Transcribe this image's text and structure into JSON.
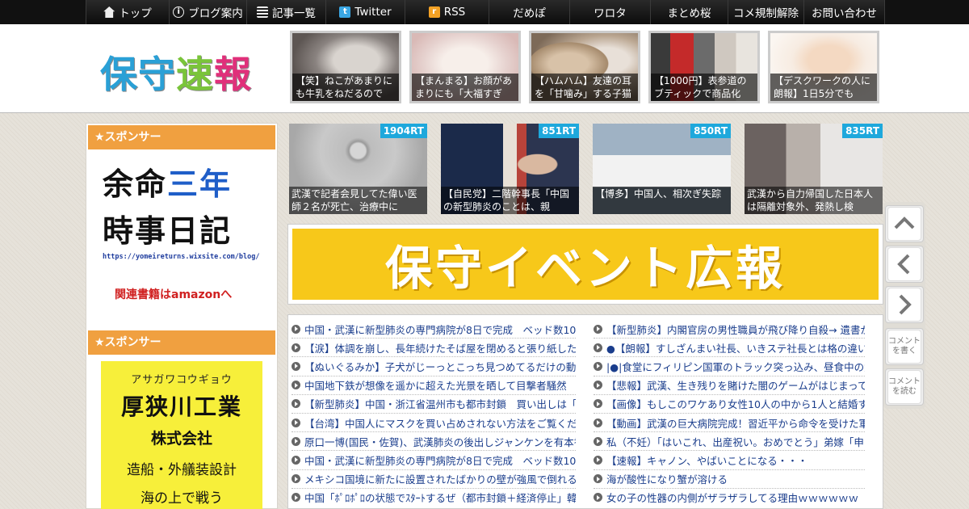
{
  "nav": {
    "items": [
      {
        "label": "トップ",
        "icon": "home-icon",
        "w": 104
      },
      {
        "label": "ブログ案内",
        "icon": "info-icon",
        "w": 96
      },
      {
        "label": "記事一覧",
        "icon": "list-icon",
        "w": 98
      },
      {
        "label": "Twitter",
        "icon": "twitter-icon",
        "w": 98
      },
      {
        "label": "RSS",
        "icon": "rss-icon",
        "w": 104
      },
      {
        "label": "だめぽ",
        "icon": "",
        "w": 100
      },
      {
        "label": "ワロタ",
        "icon": "",
        "w": 100
      },
      {
        "label": "まとめ桜",
        "icon": "",
        "w": 96
      },
      {
        "label": "コメ規制解除",
        "icon": "",
        "w": 94
      },
      {
        "label": "お問い合わせ",
        "icon": "",
        "w": 100
      }
    ]
  },
  "site": {
    "logo": [
      "保",
      "守",
      "速",
      "報"
    ]
  },
  "header_tiles": [
    {
      "caption": "【笑】ねこがあまりにも牛乳をねだるので"
    },
    {
      "caption": "【まんまる】お顔があまりにも「大福すぎる」"
    },
    {
      "caption": "【ハムハム】友達の耳を「甘噛み」する子猫"
    },
    {
      "caption": "【1000円】表参道のブティックで商品化"
    },
    {
      "caption": "【デスクワークの人に朗報】1日5分でも"
    }
  ],
  "sidebar": {
    "sponsor_label": "★スポンサー",
    "ad1": {
      "line1_a": "余命",
      "line1_b": "三年",
      "line2": "時事日記",
      "url": "https://yomeireturns.wixsite.com/blog/",
      "amazon": "関連書籍はamazonへ"
    },
    "ad2": {
      "sub": "アサガワコウギョウ",
      "title": "厚狭川工業",
      "company": "株式会社",
      "biz": "造船・外艤装設計",
      "more": "海の上で戦う"
    }
  },
  "ranking": [
    {
      "rt": "1904RT",
      "caption": "武漢で記者会見してた偉い医師２名が死亡、治療中に"
    },
    {
      "rt": "851RT",
      "caption": "【自民党】二階幹事長「中国の新型肺炎のことは、親"
    },
    {
      "rt": "850RT",
      "caption": "【博多】中国人、相次ぎ失踪"
    },
    {
      "rt": "835RT",
      "caption": "武漢から自力帰国した日本人は隔離対象外、発熱し検"
    }
  ],
  "banner": {
    "text": "保守イベント広報"
  },
  "articles_left": [
    "中国・武漢に新型肺炎の専門病院が8日で完成　ベッド数1000床",
    "【涙】体調を崩し、長年続けたそば屋を閉めると張り紙した。",
    "【ぬいぐるみか】子犬がじーっとこっち見つめてるだけの動画",
    "中国地下鉄が想像を遥かに超えた光景を晒して目撃者騒然　こ",
    "【新型肺炎】中国・浙江省温州市も都市封鎖　買い出しは「2日",
    "【台湾】中国人にマスクを買い占めされない方法をご覧ください",
    "原口一博(国民・佐賀)、武漢肺炎の後出しジャンケンを有本香氏",
    "中国・武漢に新型肺炎の専門病院が8日で完成　ベッド数1000床",
    "メキシコ国境に新たに設置されたばかりの壁が強風で倒れる",
    "中国「ﾎﾟﾛﾎﾟﾛの状態でｽﾀｰﾄするぜ（都市封鎖＋経済停止」韓国"
  ],
  "articles_right": [
    "【新型肺炎】内閣官房の男性職員が飛び降り自殺→ 遺書が・・",
    "●【朗報】すしざんまい社長、いきステ社長とは格の違いを見せ",
    "|●|食堂にフィリピン国軍のトラック突っ込み、昼食中の女子高",
    "【悲報】武漢、生き残りを賭けた闇のゲームがはじまってしまう",
    "【画像】もしこのワケあり女性10人の中から1人と結婚するとし",
    "【動画】武漢の巨大病院完成！習近平から命令を受けた軍医14",
    "私（不妊）「はいこれ、出産祝い。おめでとう」弟嫁「申し訳",
    "【速報】キャノン、やばいことになる・・・",
    "海が酸性になり蟹が溶ける",
    "女の子の性器の内側がザラザラしてる理由ｗｗｗｗｗｗ"
  ],
  "side_buttons": {
    "comment_write": "コメントを書く",
    "comment_read": "コメントを読む"
  },
  "colors": {
    "sponsor": "#f0a040",
    "rt_badge": "#1ea8dc",
    "banner": "#f7c81a",
    "link": "#1a3d8c"
  }
}
